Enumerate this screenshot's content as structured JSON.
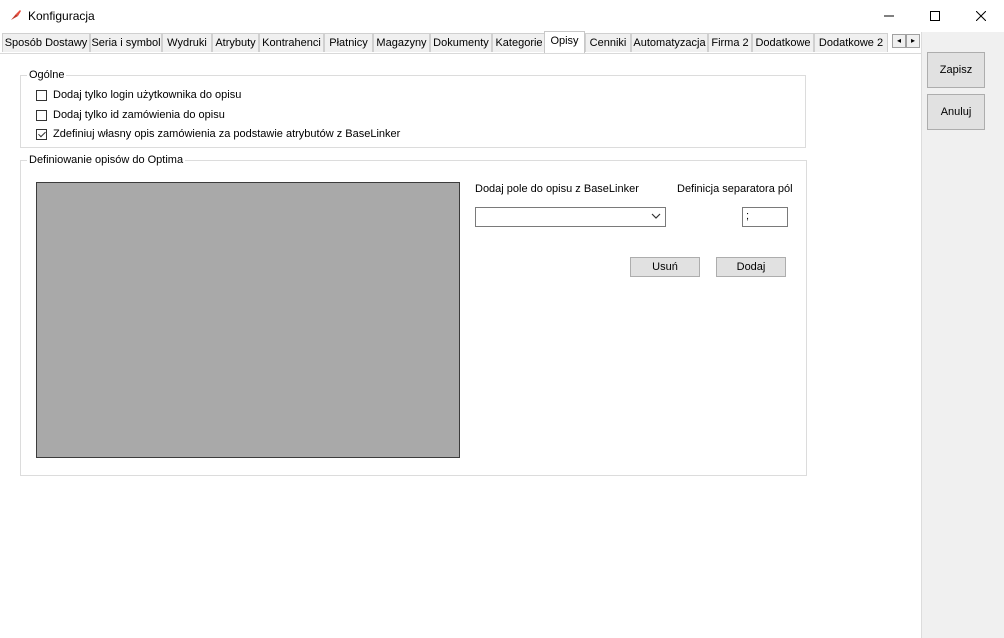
{
  "window": {
    "title": "Konfiguracja",
    "controls": {
      "minimize": "—",
      "maximize": "☐",
      "close": "✕"
    }
  },
  "tabs": [
    {
      "label": "Sposób Dostawy"
    },
    {
      "label": "Seria i symbol"
    },
    {
      "label": "Wydruki"
    },
    {
      "label": "Atrybuty"
    },
    {
      "label": "Kontrahenci"
    },
    {
      "label": "Płatnicy"
    },
    {
      "label": "Magazyny"
    },
    {
      "label": "Dokumenty"
    },
    {
      "label": "Kategorie"
    },
    {
      "label": "Opisy"
    },
    {
      "label": "Cenniki"
    },
    {
      "label": "Automatyzacja"
    },
    {
      "label": "Firma 2"
    },
    {
      "label": "Dodatkowe"
    },
    {
      "label": "Dodatkowe 2"
    }
  ],
  "active_tab": "Opisy",
  "tab_scroll": {
    "left": "◂",
    "right": "▸"
  },
  "general": {
    "legend": "Ogólne",
    "options": [
      {
        "label": "Dodaj tylko login użytkownika do opisu",
        "checked": false
      },
      {
        "label": "Dodaj tylko id zamówienia do opisu",
        "checked": false
      },
      {
        "label": "Zdefiniuj własny opis zamówienia za podstawie atrybutów z BaseLinker",
        "checked": true
      }
    ]
  },
  "definitions": {
    "legend": "Definiowanie opisów do Optima",
    "add_field_label": "Dodaj pole do opisu z BaseLinker",
    "add_field_value": "",
    "separator_label": "Definicja separatora pól",
    "separator_value": ";",
    "remove_button": "Usuń",
    "add_button": "Dodaj"
  },
  "actions": {
    "save": "Zapisz",
    "cancel": "Anuluj"
  }
}
